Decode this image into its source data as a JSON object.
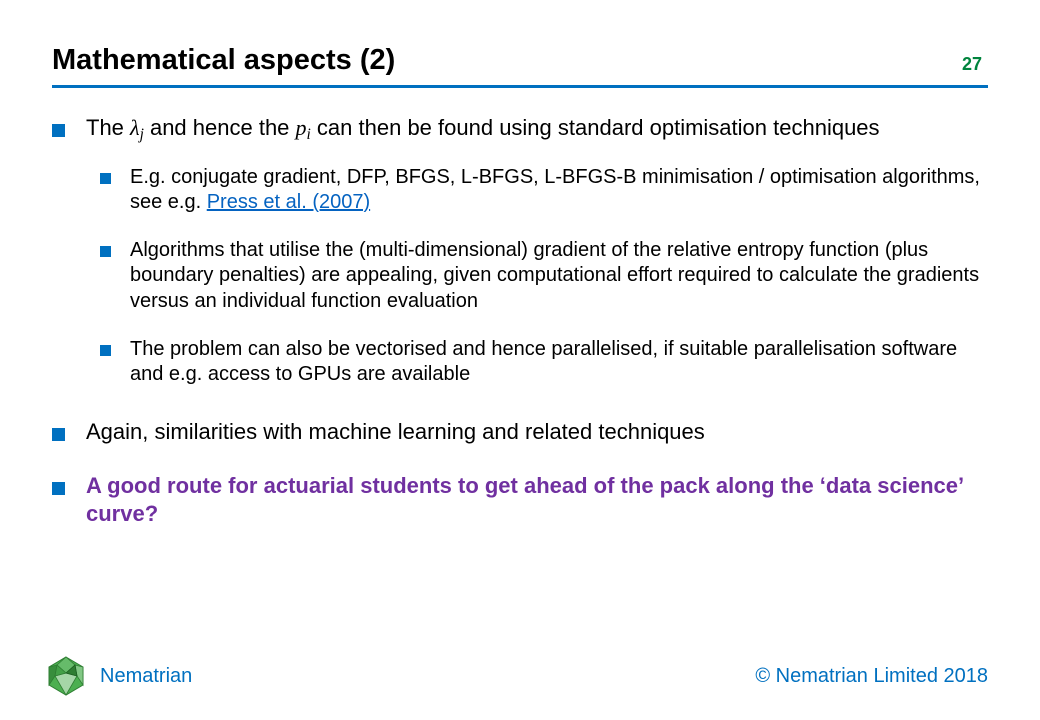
{
  "header": {
    "title": "Mathematical aspects (2)",
    "page_number": "27"
  },
  "bullets": {
    "item1": {
      "pre": "The ",
      "sym1": "λ",
      "sub1": "j",
      "mid1": " and hence the ",
      "sym2": "p",
      "sub2": "i",
      "post": " can then be found using standard optimisation techniques"
    },
    "item1_sub": {
      "a_pre": "E.g. conjugate gradient, DFP, BFGS, L-BFGS, L-BFGS-B minimisation / optimisation algorithms, see e.g. ",
      "a_link": "Press et al. (2007)",
      "b": "Algorithms that utilise the (multi-dimensional) gradient of the relative entropy function (plus boundary penalties) are appealing, given computational effort required to calculate the gradients versus an individual function evaluation",
      "c": "The problem can also be vectorised and hence parallelised, if suitable parallelisation software and e.g. access to GPUs are available"
    },
    "item2": "Again, similarities with machine learning and related techniques",
    "item3": "A good route for actuarial students to get ahead of the pack along the ‘data science’ curve?"
  },
  "footer": {
    "brand": "Nematrian",
    "copyright": "© Nematrian Limited 2018"
  }
}
